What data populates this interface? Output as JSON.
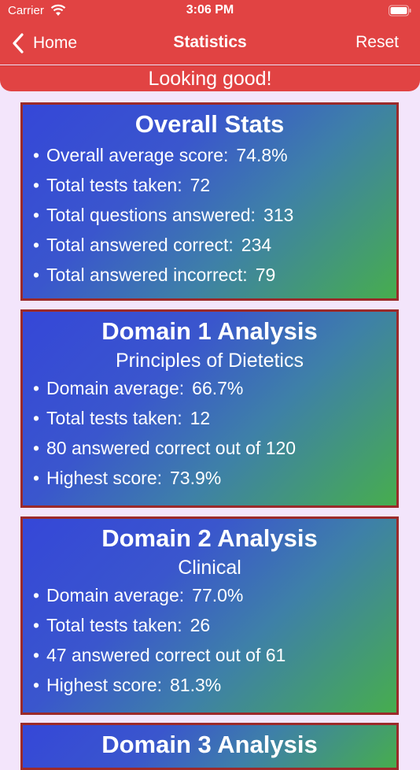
{
  "status_bar": {
    "carrier": "Carrier",
    "time": "3:06 PM"
  },
  "nav": {
    "back_label": "Home",
    "title": "Statistics",
    "reset_label": "Reset"
  },
  "banner": "Looking good!",
  "overall": {
    "title": "Overall Stats",
    "stats": [
      {
        "label": "Overall average score:",
        "value": "74.8%"
      },
      {
        "label": "Total tests taken:",
        "value": "72"
      },
      {
        "label": "Total questions answered:",
        "value": "313"
      },
      {
        "label": "Total answered correct:",
        "value": "234"
      },
      {
        "label": "Total answered incorrect:",
        "value": "79"
      }
    ]
  },
  "domain1": {
    "title": "Domain 1 Analysis",
    "subtitle": "Principles of Dietetics",
    "average_label": "Domain average:",
    "average_value": "66.7%",
    "tests_label": "Total tests taken:",
    "tests_value": "12",
    "correct_text": "80 answered correct out of 120",
    "highest_label": "Highest score:",
    "highest_value": "73.9%"
  },
  "domain2": {
    "title": "Domain 2 Analysis",
    "subtitle": "Clinical",
    "average_label": "Domain average:",
    "average_value": "77.0%",
    "tests_label": "Total tests taken:",
    "tests_value": "26",
    "correct_text": "47 answered correct out of 61",
    "highest_label": "Highest score:",
    "highest_value": "81.3%"
  },
  "domain3": {
    "title": "Domain 3 Analysis"
  }
}
